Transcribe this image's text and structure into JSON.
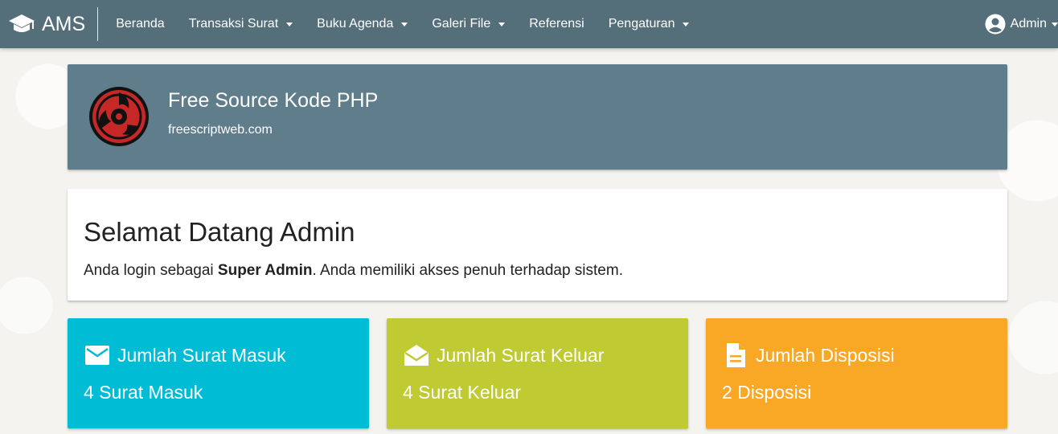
{
  "navbar": {
    "brand_icon": "graduation-cap-icon",
    "brand": "AMS",
    "menu": [
      {
        "label": "Beranda",
        "dropdown": false
      },
      {
        "label": "Transaksi Surat",
        "dropdown": true
      },
      {
        "label": "Buku Agenda",
        "dropdown": true
      },
      {
        "label": "Galeri File",
        "dropdown": true
      },
      {
        "label": "Referensi",
        "dropdown": false
      },
      {
        "label": "Pengaturan",
        "dropdown": true
      }
    ],
    "user_icon": "account-circle-icon",
    "user": "Admin"
  },
  "profile": {
    "title": "Free Source Kode PHP",
    "subtitle": "freescriptweb.com",
    "logo": "sharingan-logo"
  },
  "welcome": {
    "title": "Selamat Datang Admin",
    "text_before": "Anda login sebagai ",
    "role": "Super Admin",
    "text_after": ". Anda memiliki akses penuh terhadap sistem."
  },
  "stats": [
    {
      "icon": "mail-icon",
      "title": "Jumlah Surat Masuk",
      "value": "4 Surat Masuk",
      "color": "#00bcd4"
    },
    {
      "icon": "drafts-icon",
      "title": "Jumlah Surat Keluar",
      "value": "4 Surat Keluar",
      "color": "#c0ca33"
    },
    {
      "icon": "description-icon",
      "title": "Jumlah Disposisi",
      "value": "2 Disposisi",
      "color": "#f9a825"
    }
  ],
  "colors": {
    "navbar": "#546e7a",
    "profile_card": "#607d8b"
  }
}
